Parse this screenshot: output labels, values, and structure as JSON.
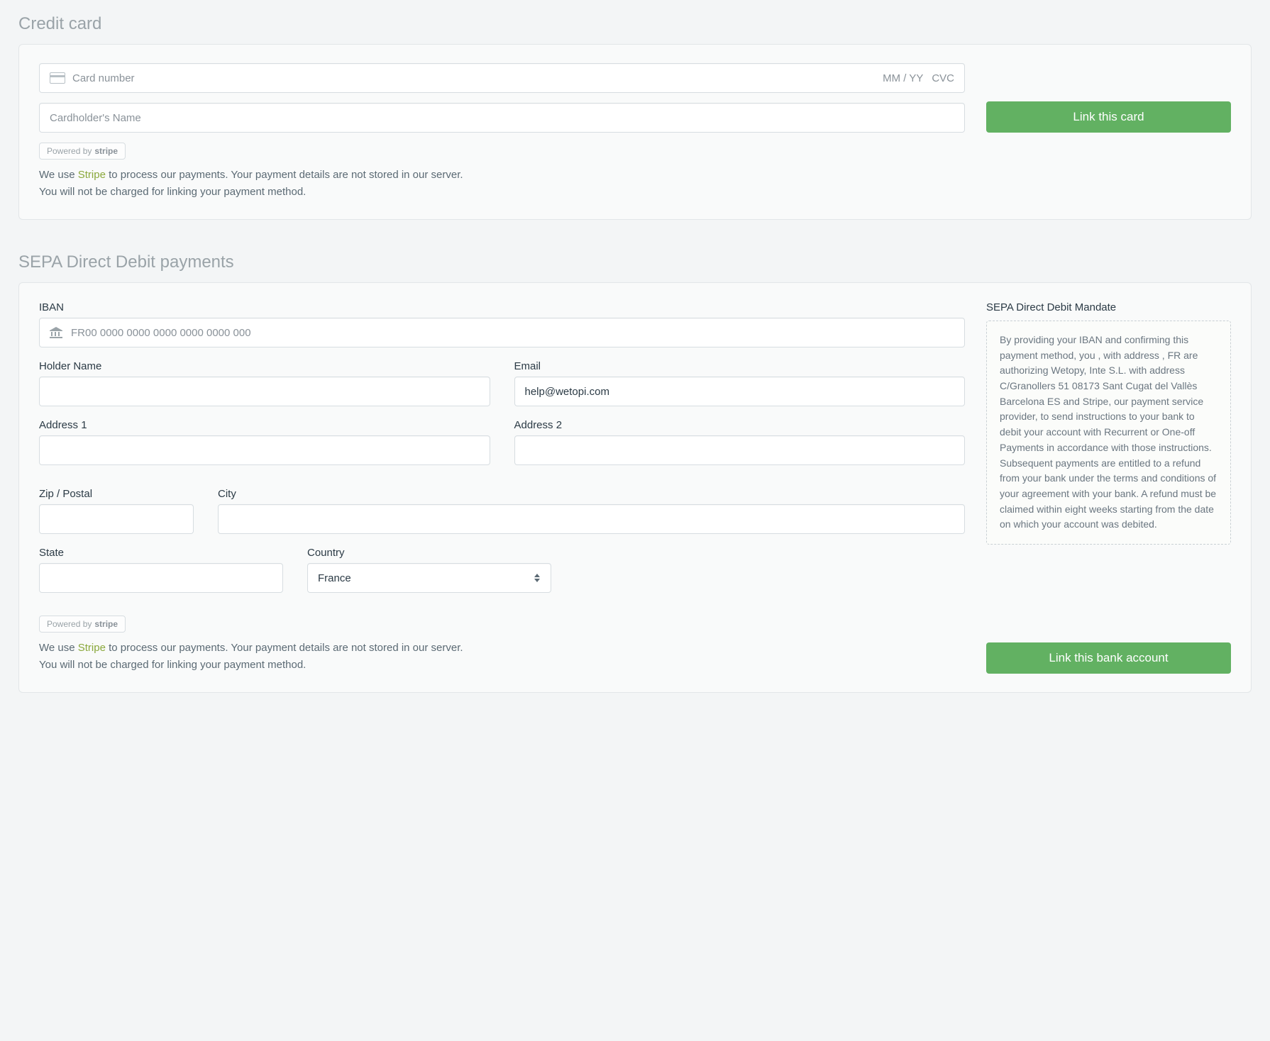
{
  "credit_card": {
    "title": "Credit card",
    "card_number_placeholder": "Card number",
    "expiry_placeholder": "MM / YY",
    "cvc_placeholder": "CVC",
    "cardholder_placeholder": "Cardholder's Name",
    "link_button": "Link this card",
    "stripe_badge_prefix": "Powered by",
    "stripe_badge_name": "stripe",
    "disclaimer_prefix": "We use ",
    "stripe_link_text": "Stripe",
    "disclaimer_suffix": " to process our payments. Your payment details are not stored in our server.",
    "disclaimer_line2": "You will not be charged for linking your payment method."
  },
  "sepa": {
    "title": "SEPA Direct Debit payments",
    "iban_label": "IBAN",
    "iban_placeholder": "FR00 0000 0000 0000 0000 0000 000",
    "holder_name_label": "Holder Name",
    "email_label": "Email",
    "email_value": "help@wetopi.com",
    "address1_label": "Address 1",
    "address2_label": "Address 2",
    "zip_label": "Zip / Postal",
    "city_label": "City",
    "state_label": "State",
    "country_label": "Country",
    "country_value": "France",
    "link_button": "Link this bank account",
    "mandate_title": "SEPA Direct Debit Mandate",
    "mandate_text": "By providing your IBAN and confirming this payment method, you , with address , FR are authorizing Wetopy, Inte S.L. with address C/Granollers 51 08173 Sant Cugat del Vallès Barcelona ES and Stripe, our payment service provider, to send instructions to your bank to debit your account with Recurrent or One-off Payments in accordance with those instructions. Subsequent payments are entitled to a refund from your bank under the terms and conditions of your agreement with your bank. A refund must be claimed within eight weeks starting from the date on which your account was debited.",
    "stripe_badge_prefix": "Powered by",
    "stripe_badge_name": "stripe",
    "disclaimer_prefix": "We use ",
    "stripe_link_text": "Stripe",
    "disclaimer_suffix": " to process our payments. Your payment details are not stored in our server.",
    "disclaimer_line2": "You will not be charged for linking your payment method."
  }
}
